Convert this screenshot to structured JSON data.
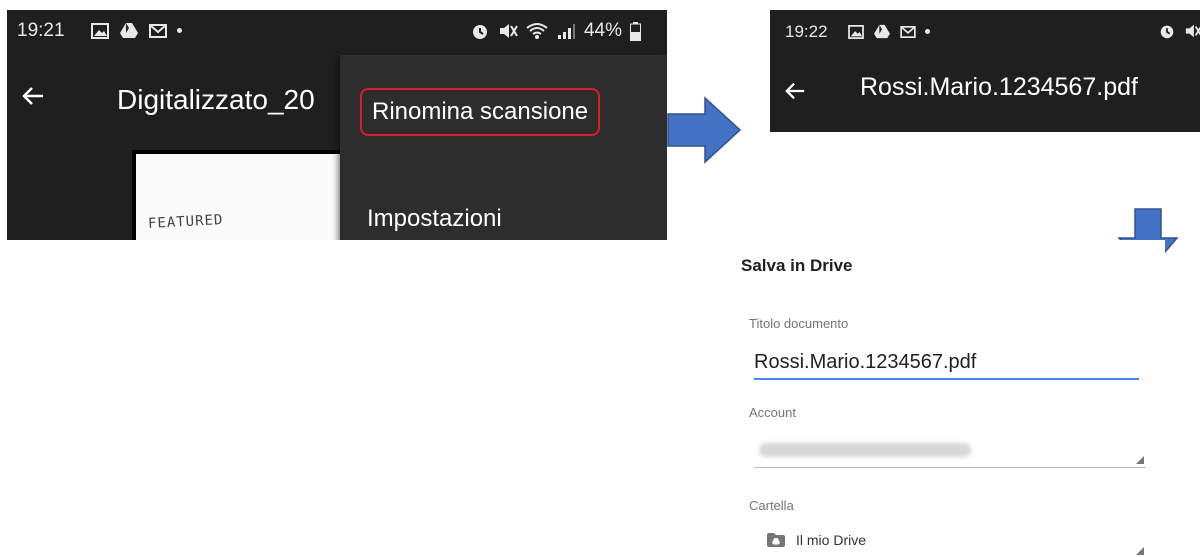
{
  "step1": {
    "status": {
      "time": "19:21",
      "battery": "44%"
    },
    "app_title": "Digitalizzato_20",
    "preview_text": "FEATURED",
    "menu": {
      "rename": "Rinomina scansione",
      "settings": "Impostazioni"
    },
    "colors": {
      "highlight": "#d6202a",
      "toolbar_bg": "#1f1f1f",
      "menu_bg": "#2d2d2d"
    }
  },
  "step2": {
    "status": {
      "time": "19:22"
    },
    "app_title": "Rossi.Mario.1234567.pdf"
  },
  "step3": {
    "dialog_title": "Salva in Drive",
    "document_title_label": "Titolo documento",
    "document_title_value": "Rossi.Mario.1234567.pdf",
    "account_label": "Account",
    "folder_label": "Cartella",
    "folder_value": "Il mio Drive",
    "colors": {
      "accent": "#4285f4"
    }
  },
  "arrows": {
    "color": "#4472c4",
    "icons": [
      "arrow-right-icon",
      "arrow-down-icon"
    ]
  }
}
